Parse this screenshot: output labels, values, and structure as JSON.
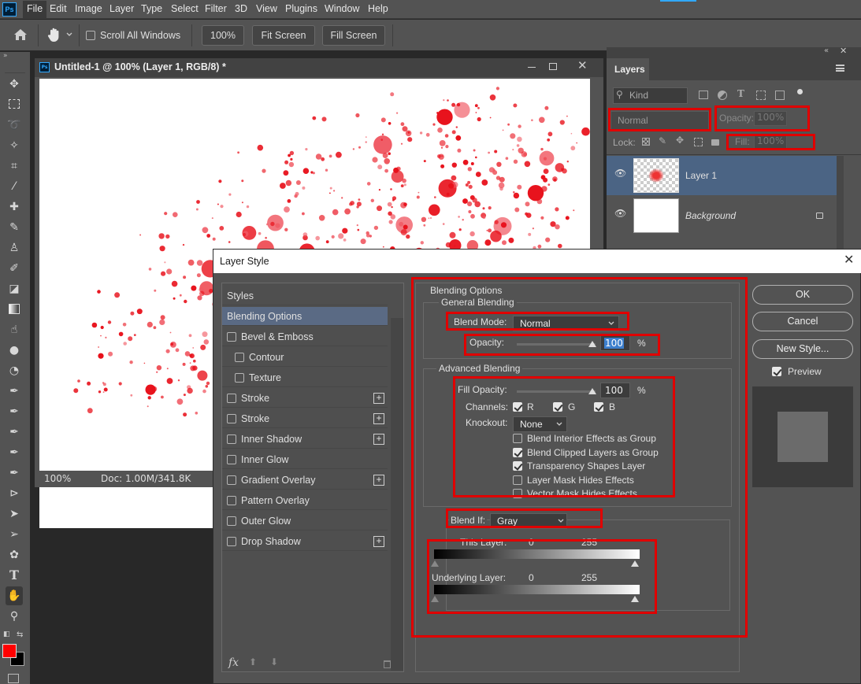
{
  "app": {
    "logo": "Ps"
  },
  "menu": [
    "File",
    "Edit",
    "Image",
    "Layer",
    "Type",
    "Select",
    "Filter",
    "3D",
    "View",
    "Plugins",
    "Window",
    "Help"
  ],
  "options": {
    "scroll_all_windows": "Scroll All Windows",
    "zoom": "100%",
    "fit_screen": "Fit Screen",
    "fill_screen": "Fill Screen"
  },
  "document": {
    "title": "Untitled-1 @ 100% (Layer 1, RGB/8) *",
    "zoom": "100%",
    "doc_info": "Doc: 1.00M/341.8K"
  },
  "layers_panel": {
    "title": "Layers",
    "filter_kind": "Kind",
    "blend_mode": "Normal",
    "opacity_label": "Opacity:",
    "opacity_value": "100%",
    "lock_label": "Lock:",
    "fill_label": "Fill:",
    "fill_value": "100%",
    "layers": [
      {
        "name": "Layer 1"
      },
      {
        "name": "Background"
      }
    ]
  },
  "dialog": {
    "title": "Layer Style",
    "styles": [
      {
        "label": "Styles",
        "checkbox": false,
        "plus": false,
        "indent": 0,
        "selected": false
      },
      {
        "label": "Blending Options",
        "checkbox": false,
        "plus": false,
        "indent": 0,
        "selected": true
      },
      {
        "label": "Bevel & Emboss",
        "checkbox": true,
        "plus": false,
        "indent": 0,
        "selected": false
      },
      {
        "label": "Contour",
        "checkbox": true,
        "plus": false,
        "indent": 1,
        "selected": false
      },
      {
        "label": "Texture",
        "checkbox": true,
        "plus": false,
        "indent": 1,
        "selected": false
      },
      {
        "label": "Stroke",
        "checkbox": true,
        "plus": true,
        "indent": 0,
        "selected": false
      },
      {
        "label": "Stroke",
        "checkbox": true,
        "plus": true,
        "indent": 0,
        "selected": false
      },
      {
        "label": "Inner Shadow",
        "checkbox": true,
        "plus": true,
        "indent": 0,
        "selected": false
      },
      {
        "label": "Inner Glow",
        "checkbox": true,
        "plus": false,
        "indent": 0,
        "selected": false
      },
      {
        "label": "Gradient Overlay",
        "checkbox": true,
        "plus": true,
        "indent": 0,
        "selected": false
      },
      {
        "label": "Pattern Overlay",
        "checkbox": true,
        "plus": false,
        "indent": 0,
        "selected": false
      },
      {
        "label": "Outer Glow",
        "checkbox": true,
        "plus": false,
        "indent": 0,
        "selected": false
      },
      {
        "label": "Drop Shadow",
        "checkbox": true,
        "plus": true,
        "indent": 0,
        "selected": false
      }
    ],
    "blending_options": "Blending Options",
    "general_blending": "General Blending",
    "blend_mode_label": "Blend Mode:",
    "blend_mode_value": "Normal",
    "opacity_label": "Opacity:",
    "opacity_value": "100",
    "percent": "%",
    "advanced_blending": "Advanced Blending",
    "fill_opacity_label": "Fill Opacity:",
    "fill_opacity_value": "100",
    "channels_label": "Channels:",
    "channels": [
      "R",
      "G",
      "B"
    ],
    "knockout_label": "Knockout:",
    "knockout_value": "None",
    "options": [
      {
        "label": "Blend Interior Effects as Group",
        "checked": false
      },
      {
        "label": "Blend Clipped Layers as Group",
        "checked": true
      },
      {
        "label": "Transparency Shapes Layer",
        "checked": true
      },
      {
        "label": "Layer Mask Hides Effects",
        "checked": false
      },
      {
        "label": "Vector Mask Hides Effects",
        "checked": false
      }
    ],
    "blend_if_label": "Blend If:",
    "blend_if_value": "Gray",
    "this_layer_label": "This Layer:",
    "this_layer_min": "0",
    "this_layer_max": "255",
    "underlying_label": "Underlying Layer:",
    "underlying_min": "0",
    "underlying_max": "255",
    "ok": "OK",
    "cancel": "Cancel",
    "new_style": "New Style...",
    "preview": "Preview"
  },
  "colors": {
    "highlight": "#e00000",
    "foreground": "#ff0000",
    "background": "#000000"
  }
}
